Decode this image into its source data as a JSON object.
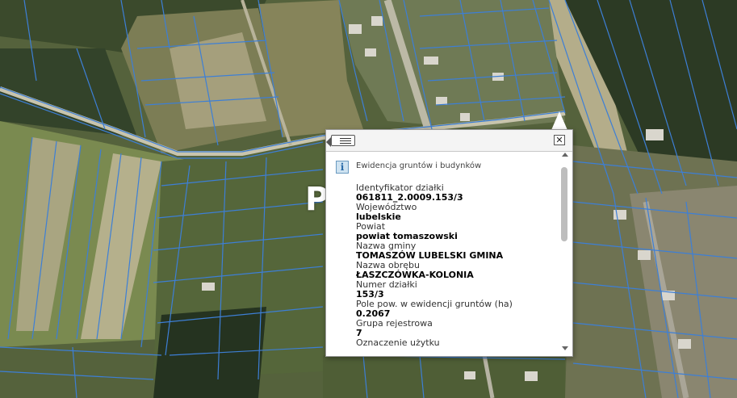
{
  "map": {
    "place_label": "Pół",
    "parcel_line_color": "#3d7fd6",
    "aerial_colors": {
      "forest": "#2f3d25",
      "field": "#8b8a62",
      "bare": "#b7ae8a",
      "road": "#b9b7a8"
    }
  },
  "popup": {
    "back_icon": "list-back-icon",
    "close_symbol": "✕",
    "info_icon_symbol": "i",
    "layer_title": "Ewidencja gruntów i budynków",
    "fields": [
      {
        "label": "Identyfikator działki",
        "value": "061811_2.0009.153/3"
      },
      {
        "label": "Województwo",
        "value": "lubelskie"
      },
      {
        "label": "Powiat",
        "value": "powiat tomaszowski"
      },
      {
        "label": "Nazwa gminy",
        "value": "TOMASZÓW LUBELSKI GMINA"
      },
      {
        "label": "Nazwa obrębu",
        "value": "ŁASZCZÓWKA-KOLONIA"
      },
      {
        "label": "Numer działki",
        "value": "153/3"
      },
      {
        "label": "Pole pow. w ewidencji gruntów (ha)",
        "value": "0.2067"
      },
      {
        "label": "Grupa rejestrowa",
        "value": "7"
      },
      {
        "label": "Oznaczenie użytku",
        "value": ""
      }
    ]
  }
}
